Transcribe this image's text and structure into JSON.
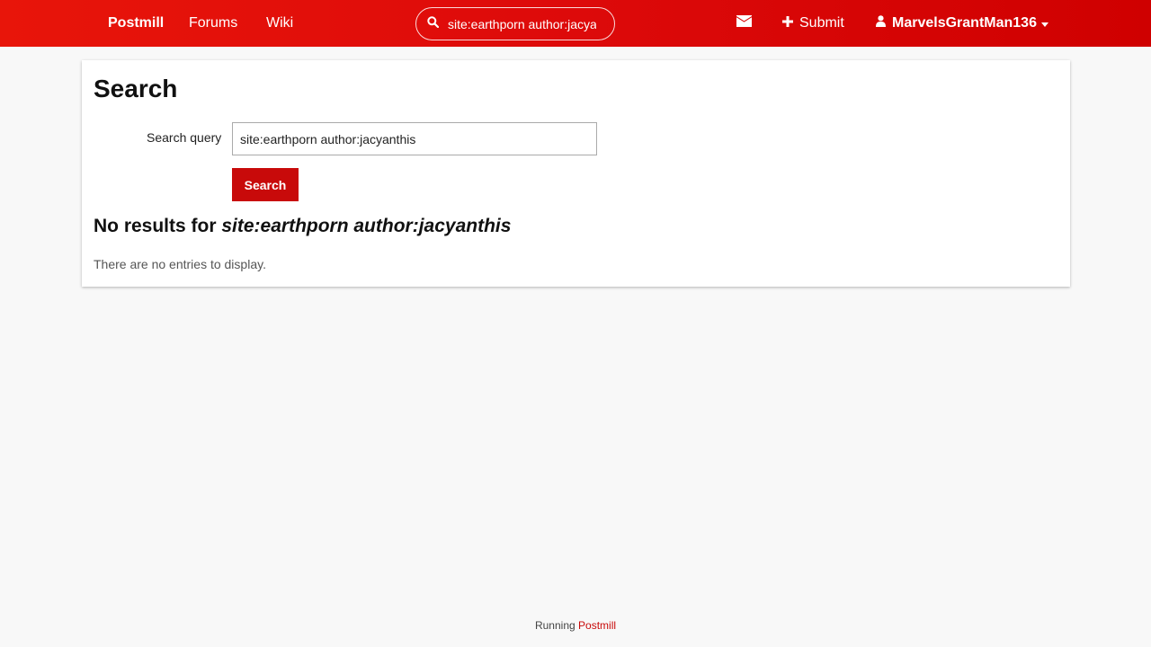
{
  "header": {
    "brand": "Postmill",
    "nav": [
      "Forums",
      "Wiki"
    ],
    "search_value": "site:earthporn author:jacyanthis",
    "submit_label": "Submit",
    "username": "MarvelsGrantMan136"
  },
  "main": {
    "title": "Search",
    "query_label": "Search query",
    "query_value": "site:earthporn author:jacyanthis",
    "search_button": "Search",
    "results_prefix": "No results for ",
    "results_query": "site:earthporn author:jacyanthis",
    "empty_message": "There are no entries to display."
  },
  "footer": {
    "prefix": "Running ",
    "link": "Postmill"
  },
  "colors": {
    "accent": "#c80a0a",
    "header_start": "#e8150a",
    "header_end": "#cf0000",
    "background": "#f8f8f8"
  },
  "icons": {
    "search": "search-icon",
    "messages": "envelope-icon",
    "submit": "plus-icon",
    "user": "user-icon",
    "menu": "caret-down-icon"
  }
}
